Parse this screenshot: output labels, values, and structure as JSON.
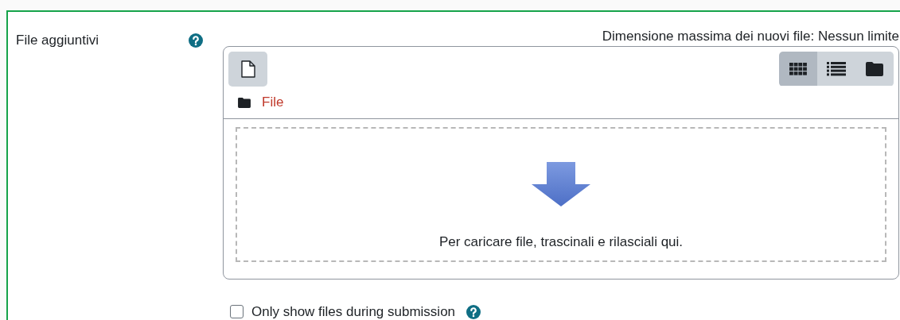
{
  "field": {
    "label": "File aggiuntivi",
    "max_size": "Dimensione massima dei nuovi file: Nessun limite"
  },
  "view_buttons": [
    {
      "kind": "icons",
      "selected": true
    },
    {
      "kind": "list",
      "selected": false
    },
    {
      "kind": "tree",
      "selected": false
    }
  ],
  "path": [
    "File"
  ],
  "dropzone": {
    "message": "Per caricare file, trascinali e rilasciali qui."
  },
  "option": {
    "label": "Only show files during submission",
    "checked": false
  }
}
